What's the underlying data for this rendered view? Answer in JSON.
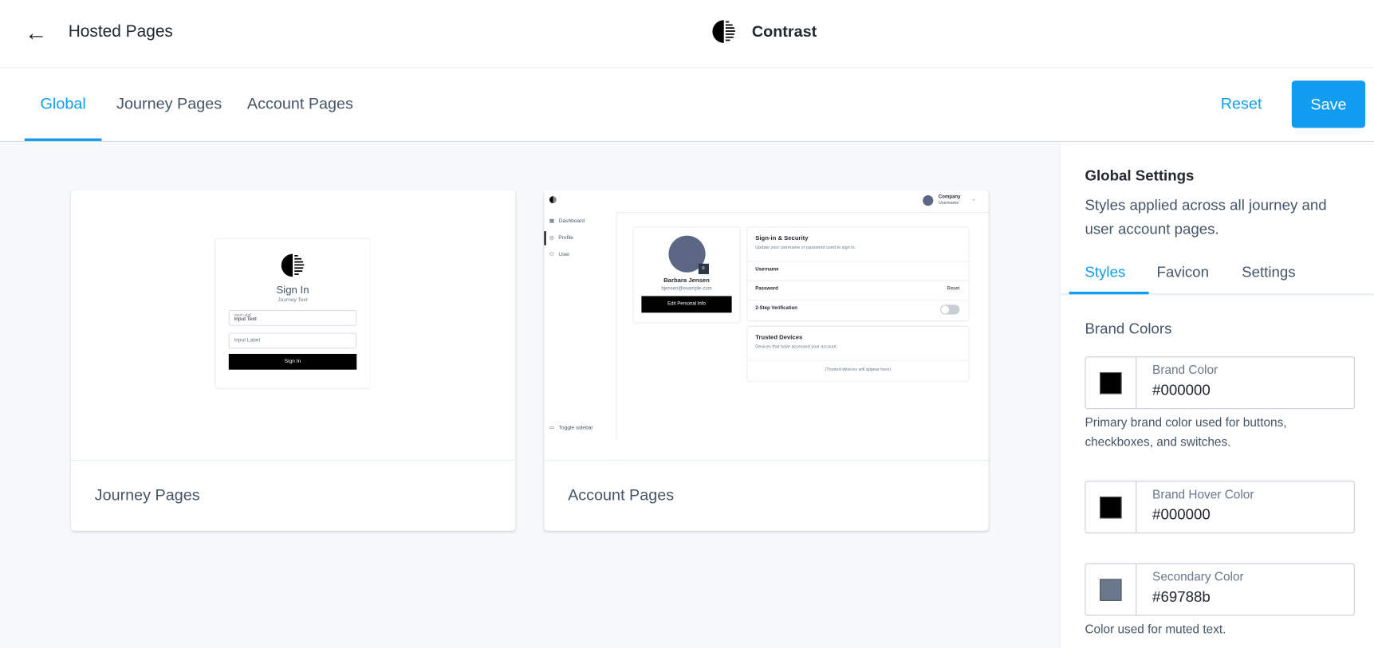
{
  "header": {
    "title": "Hosted Pages",
    "brand": "Contrast",
    "back_icon": "arrow-left-icon"
  },
  "tabs": [
    {
      "label": "Global",
      "active": true
    },
    {
      "label": "Journey Pages"
    },
    {
      "label": "Account Pages"
    }
  ],
  "actions": {
    "reset": "Reset",
    "save": "Save"
  },
  "accent": "#109cf1",
  "cards": {
    "journey": {
      "label": "Journey Pages",
      "preview": {
        "title": "Sign In",
        "subtitle": "Journey Text",
        "input_label": "Input Label",
        "input_value": "Input Text",
        "input2_placeholder": "Input Label",
        "button": "Sign In"
      }
    },
    "account": {
      "label": "Account Pages",
      "preview": {
        "company": "Company",
        "username": "Username",
        "nav": [
          "Dashboard",
          "Profile",
          "User"
        ],
        "toggle": "Toggle sidebar",
        "name": "Barbara Jensen",
        "email": "bjensen@example.com",
        "edit": "Edit Personal Info",
        "security_title": "Sign-in & Security",
        "security_desc": "Update your username or password used to sign in.",
        "rows": [
          "Username",
          "Password",
          "2-Step Verification"
        ],
        "reset": "Reset",
        "devices_title": "Trusted Devices",
        "devices_desc": "Devices that have accessed your account.",
        "devices_empty": "(Trusted devices will appear here)"
      }
    }
  },
  "panel": {
    "title": "Global Settings",
    "description": "Styles applied across all journey and user account pages.",
    "tabs": [
      {
        "label": "Styles",
        "active": true
      },
      {
        "label": "Favicon"
      },
      {
        "label": "Settings"
      }
    ],
    "section": "Brand Colors",
    "fields": [
      {
        "label": "Brand Color",
        "value": "#000000",
        "color": "#000000",
        "help": "Primary brand color used for buttons, checkboxes, and switches."
      },
      {
        "label": "Brand Hover Color",
        "value": "#000000",
        "color": "#000000"
      },
      {
        "label": "Secondary Color",
        "value": "#69788b",
        "color": "#69788b",
        "help": "Color used for muted text."
      }
    ]
  }
}
